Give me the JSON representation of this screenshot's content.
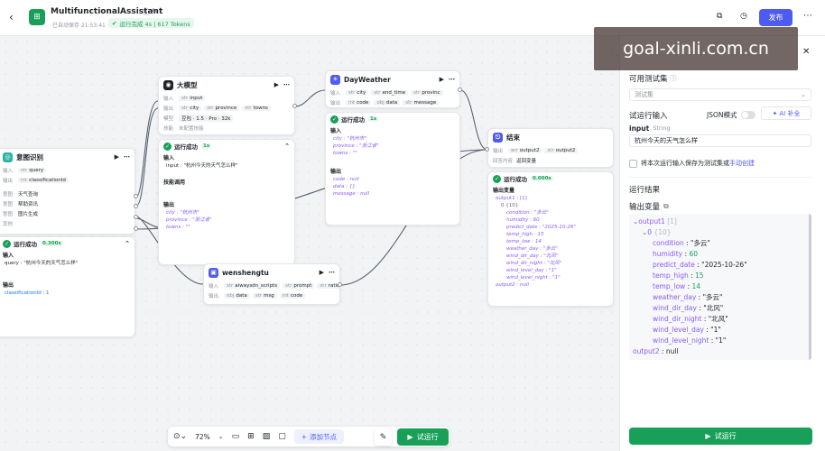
{
  "header": {
    "title": "MultifunctionalAssistant",
    "autosave": "已自动保存 21:53:41",
    "run_status": "运行完成 4s | 617 Tokens",
    "publish_label": "发布",
    "watermark": "goal-xinli.com.cn"
  },
  "nodes": {
    "intent": {
      "title": "意图识别",
      "input_label": "输入",
      "output_label": "输出",
      "inputs": [
        "query"
      ],
      "outputs": [
        "classificationId"
      ],
      "options_labels": [
        "意图",
        "意图",
        "意图",
        "其他"
      ],
      "options": [
        "天气查询",
        "帮助资讯",
        "图片生成",
        ""
      ]
    },
    "intent_result": {
      "status": "运行成功",
      "time": "0.300s",
      "input_label": "输入",
      "input_text": "query : \"杭州今天的天气怎么样\"",
      "output_label": "输出",
      "output_text": "classificationId : 1"
    },
    "llm": {
      "title": "大模型",
      "rows": [
        {
          "label": "输入",
          "tags": [
            "input"
          ]
        },
        {
          "label": "输出",
          "tags": [
            "city",
            "province",
            "towns"
          ]
        },
        {
          "label": "模型",
          "tags": [
            "豆包 · 1.5 · Pro · 32k"
          ]
        },
        {
          "label": "技能",
          "tags": [
            "未配置技能"
          ]
        }
      ]
    },
    "llm_result": {
      "status": "运行成功",
      "time": "1s",
      "input_label": "输入",
      "input_text": "input : \"杭州今天的天气怎么样\"",
      "skill_label": "技能调用",
      "output_label": "输出",
      "out_lines": [
        "city : \"杭州市\"",
        "province : \"浙江省\"",
        "towns : \"\""
      ]
    },
    "weather": {
      "title": "DayWeather",
      "rows": [
        {
          "label": "输入",
          "tags": [
            "city",
            "end_time",
            "provinc"
          ]
        },
        {
          "label": "输出",
          "tags": [
            "code",
            "data",
            "message"
          ]
        }
      ]
    },
    "weather_result": {
      "status": "运行成功",
      "time": "1s",
      "input_label": "输入",
      "in_lines": [
        "city : \"杭州市\"",
        "province : \"浙江省\"",
        "towns : \"\""
      ],
      "output_label": "输出",
      "out_lines": [
        "code : null",
        "data : {}",
        "message : null"
      ]
    },
    "wenshengtu": {
      "title": "wenshengtu",
      "rows": [
        {
          "label": "输入",
          "tags": [
            "aiwaysdn_scripts",
            "prompt",
            "ratio"
          ]
        },
        {
          "label": "输出",
          "tags": [
            "data",
            "msg",
            "code"
          ]
        }
      ]
    },
    "end": {
      "title": "结束",
      "rows": [
        {
          "label": "输出",
          "tags": [
            "output2",
            "output2"
          ]
        },
        {
          "label": "回答内容",
          "tags": [
            "返回变量"
          ]
        }
      ]
    },
    "end_result": {
      "status": "运行成功",
      "time": "0.000s",
      "out_label": "输出变量",
      "lines": [
        "output1 : [1]",
        "0 {10}",
        "condition : \"多云\"",
        "humidity : 60",
        "predict_date : \"2025-10-26\"",
        "temp_high : 15",
        "temp_low : 14",
        "weather_day : \"多云\"",
        "wind_dir_day : \"北风\"",
        "wind_dir_night : \"北风\"",
        "wind_level_day : \"1\"",
        "wind_level_night : \"1\"",
        "output2 : null"
      ]
    }
  },
  "panel": {
    "test_set_label": "可用测试集",
    "test_set_placeholder": "测试集",
    "trial_input_label": "试运行输入",
    "json_mode_label": "JSON模式",
    "ai_fill_label": "AI 补全",
    "field_name": "input",
    "field_type": "String",
    "field_value": "杭州今天的天气怎么样",
    "save_text": "将本次运行输入保存为测试集或",
    "manual_link": "手动创建",
    "result_label": "运行结果",
    "output_var_label": "输出变量",
    "tree": {
      "output1_key": "output1",
      "output1_meta": "[1]",
      "item_key": "0",
      "item_meta": "{10}",
      "fields": [
        {
          "key": "condition",
          "value": "\"多云\"",
          "kind": "string"
        },
        {
          "key": "humidity",
          "value": "60",
          "kind": "number"
        },
        {
          "key": "predict_date",
          "value": "\"2025-10-26\"",
          "kind": "string"
        },
        {
          "key": "temp_high",
          "value": "15",
          "kind": "number"
        },
        {
          "key": "temp_low",
          "value": "14",
          "kind": "number"
        },
        {
          "key": "weather_day",
          "value": "\"多云\"",
          "kind": "string"
        },
        {
          "key": "wind_dir_day",
          "value": "\"北风\"",
          "kind": "string"
        },
        {
          "key": "wind_dir_night",
          "value": "\"北风\"",
          "kind": "string"
        },
        {
          "key": "wind_level_day",
          "value": "\"1\"",
          "kind": "string"
        },
        {
          "key": "wind_level_night",
          "value": "\"1\"",
          "kind": "string"
        }
      ],
      "output2_key": "output2",
      "output2_value": "null"
    },
    "run_button_label": "试运行"
  },
  "toolbar": {
    "zoom": "72%",
    "add_node_label": "添加节点",
    "trial_run_label": "试运行"
  },
  "colors": {
    "accent": "#4e5bf2",
    "success": "#18a058",
    "edge": "#5a6270"
  }
}
